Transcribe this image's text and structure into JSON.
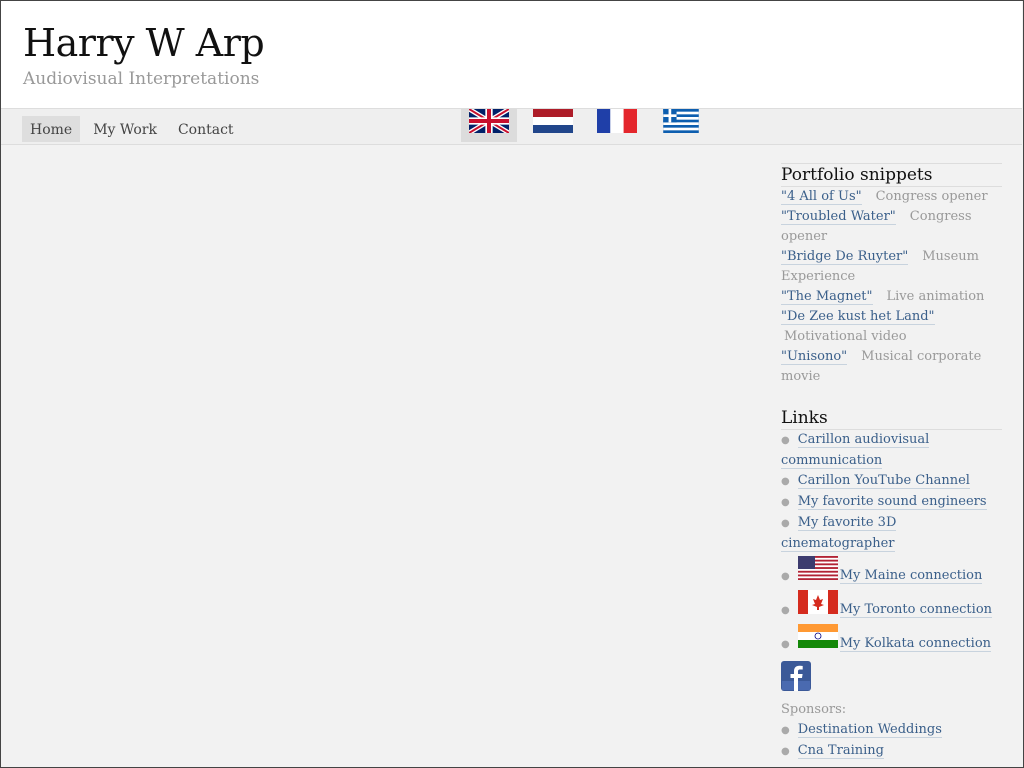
{
  "site": {
    "title": "Harry W Arp",
    "tagline": "Audiovisual Interpretations"
  },
  "nav": {
    "items": [
      {
        "label": "Home"
      },
      {
        "label": "My Work"
      },
      {
        "label": "Contact"
      }
    ]
  },
  "flags": [
    {
      "icon": "uk-flag-icon"
    },
    {
      "icon": "netherlands-flag-icon"
    },
    {
      "icon": "france-flag-icon"
    },
    {
      "icon": "greece-flag-icon"
    }
  ],
  "sidebar": {
    "portfolio_title": "Portfolio snippets",
    "snippets": [
      {
        "link": "\"4 All of Us\"",
        "desc": "Congress opener"
      },
      {
        "link": "\"Troubled Water\"",
        "desc": "Congress opener"
      },
      {
        "link": "\"Bridge De Ruyter\"",
        "desc": "Museum Experience"
      },
      {
        "link": "\"The Magnet\"",
        "desc": "Live animation"
      },
      {
        "link": "\"De Zee kust het Land\"",
        "desc": "Motivational video"
      },
      {
        "link": "\"Unisono\"",
        "desc": "Musical corporate movie"
      }
    ],
    "links_title": "Links",
    "links": [
      {
        "label": "Carillon audiovisual communication"
      },
      {
        "label": "Carillon YouTube Channel"
      },
      {
        "label": "My favorite sound engineers"
      },
      {
        "label": "My favorite 3D cinematographer"
      },
      {
        "label": "My Maine connection",
        "icon": "usa-flag-icon"
      },
      {
        "label": "My Toronto connection",
        "icon": "canada-flag-icon"
      },
      {
        "label": "My Kolkata connection",
        "icon": "india-flag-icon"
      }
    ],
    "sponsors_label": "Sponsors:",
    "sponsors": [
      {
        "label": "Destination Weddings"
      },
      {
        "label": "Cna Training"
      }
    ]
  },
  "colors": {
    "link": "#3a5f8a",
    "muted": "#999999",
    "background": "#f2f2f2"
  }
}
